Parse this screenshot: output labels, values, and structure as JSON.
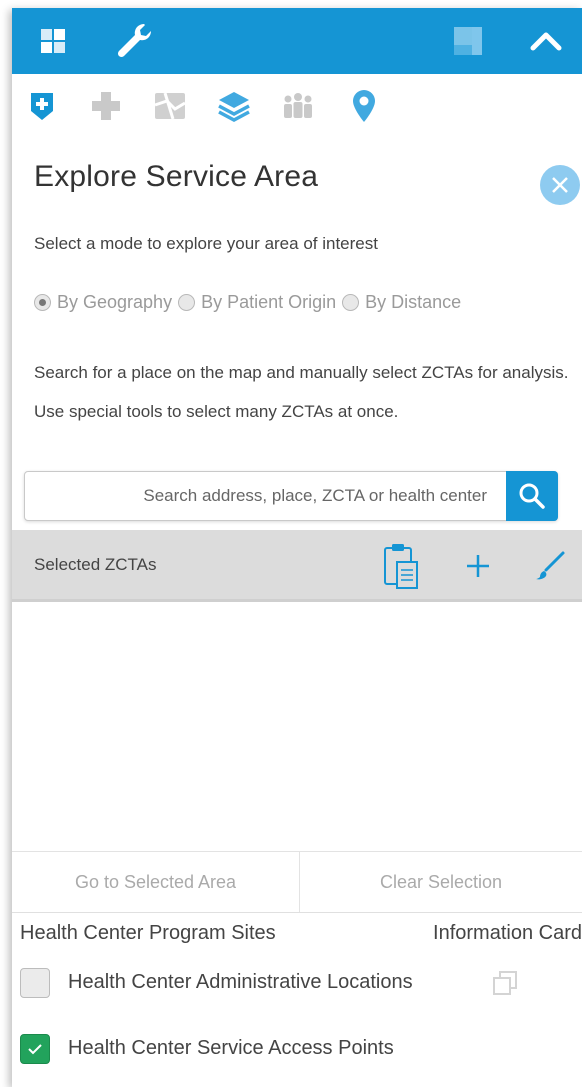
{
  "colors": {
    "primary_blue": "#1595d4",
    "close_blue": "#8ecbf0",
    "check_green": "#22a35c",
    "header_gray": "#dcdcdc"
  },
  "topbar": {
    "icons": [
      "grid-icon",
      "wrench-icon",
      "panel-toggle-icon",
      "chevron-up-icon"
    ]
  },
  "tools": [
    "shield-plus-icon",
    "plus-icon",
    "map-icon",
    "layers-icon",
    "people-icon",
    "location-pin-icon"
  ],
  "panel": {
    "title": "Explore Service Area",
    "mode_prompt": "Select a mode to explore your area of interest",
    "modes": [
      {
        "label": "By Geography",
        "selected": true
      },
      {
        "label": "By Patient Origin",
        "selected": false
      },
      {
        "label": "By Distance",
        "selected": false
      }
    ],
    "description": "Search for a place on the map and manually select ZCTAs for analysis. Use special tools to select many ZCTAs at once.",
    "search": {
      "placeholder": "Search address, place, ZCTA or health center",
      "value": ""
    }
  },
  "selected": {
    "header": "Selected ZCTAs",
    "items": []
  },
  "actions": {
    "go_label": "Go to Selected Area",
    "clear_label": "Clear Selection"
  },
  "sites": {
    "heading": "Health Center Program Sites",
    "info_heading": "Information Card",
    "rows": [
      {
        "label": "Health Center Administrative Locations",
        "checked": false,
        "info_checked": true
      },
      {
        "label": "Health Center Service Access Points",
        "checked": true,
        "info_checked": true
      }
    ]
  }
}
